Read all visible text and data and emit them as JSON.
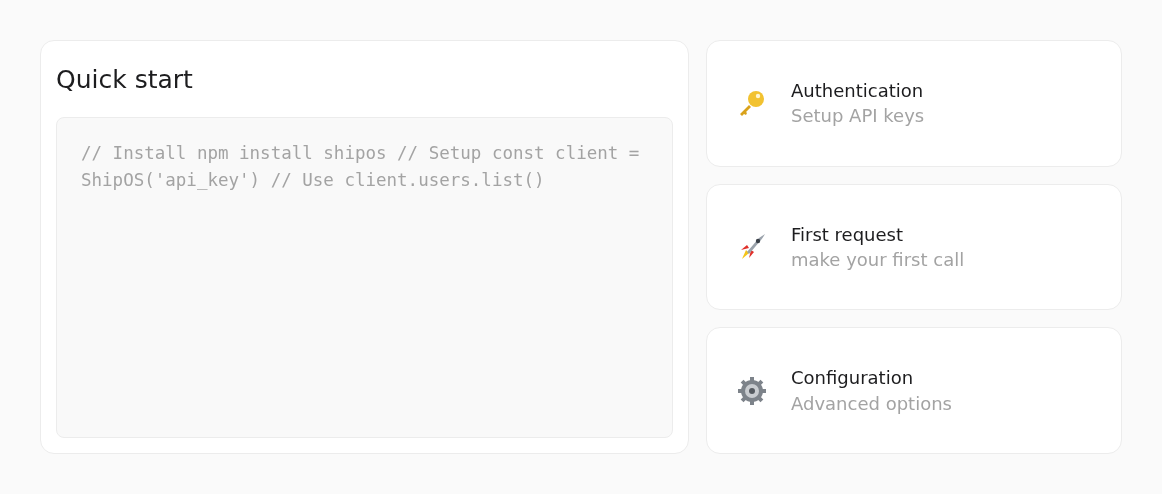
{
  "quick_start": {
    "title": "Quick start",
    "code": "// Install npm install shipos // Setup const client = ShipOS('api_key') // Use client.users.list()"
  },
  "links": [
    {
      "kind": "key",
      "title": "Authentication",
      "subtitle": "Setup API keys"
    },
    {
      "kind": "rocket",
      "title": "First request",
      "subtitle": "make your first call"
    },
    {
      "kind": "gear",
      "title": "Configuration",
      "subtitle": "Advanced options"
    }
  ]
}
